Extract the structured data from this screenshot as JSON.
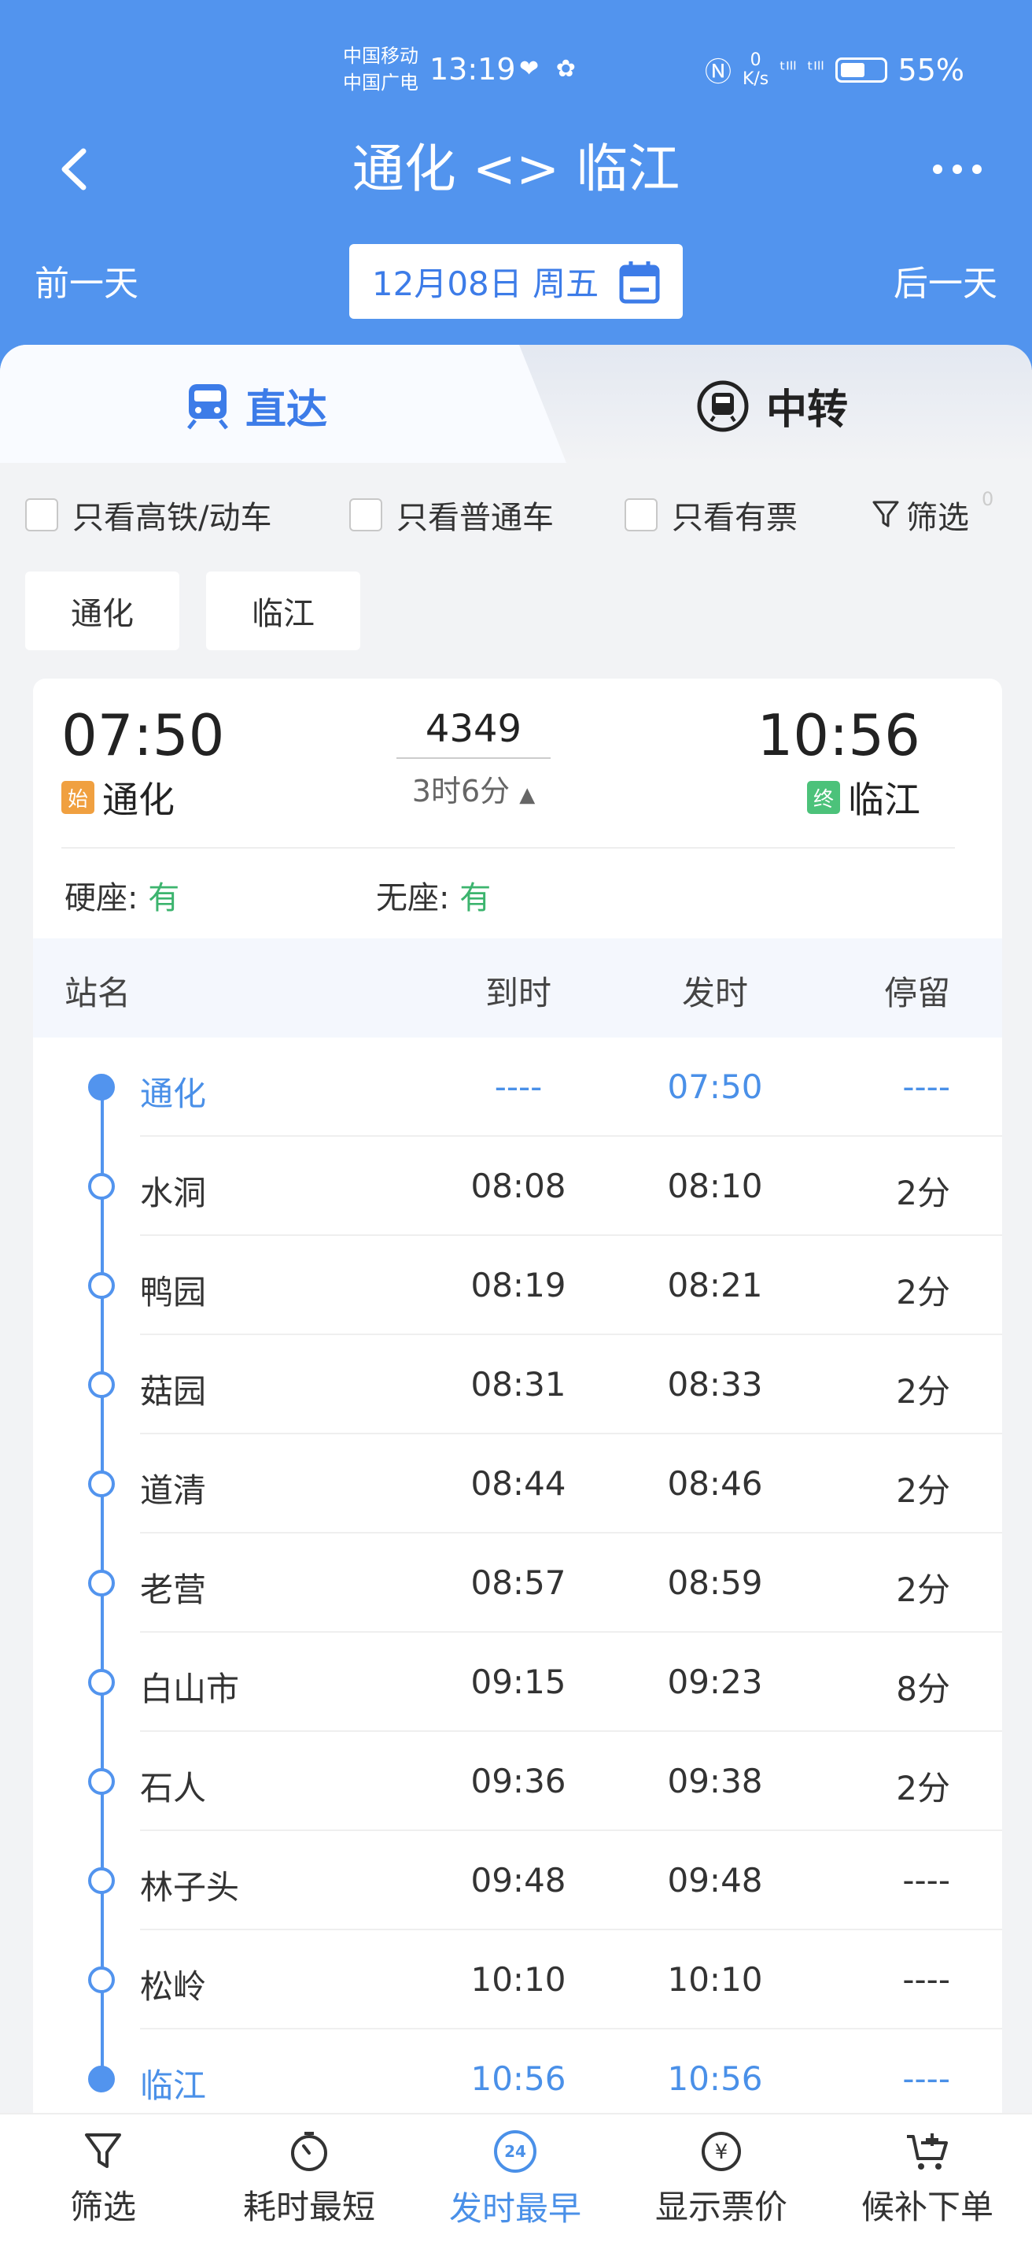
{
  "status_bar": {
    "carrier1": "中国移动",
    "carrier2": "中国广电",
    "time": "13:19",
    "net_speed_value": "0",
    "net_speed_unit": "K/s",
    "battery": "55%"
  },
  "nav": {
    "title": "通化 <> 临江"
  },
  "date_bar": {
    "prev": "前一天",
    "date": "12月08日 周五",
    "next": "后一天"
  },
  "tabs": [
    {
      "label": "直达"
    },
    {
      "label": "中转"
    }
  ],
  "filters": {
    "high_speed": "只看高铁/动车",
    "regular": "只看普通车",
    "has_ticket": "只看有票",
    "filter": "筛选",
    "filter_count": "0"
  },
  "station_chips": [
    "通化",
    "临江"
  ],
  "train": {
    "depart_time": "07:50",
    "depart_station": "通化",
    "start_badge": "始",
    "arrive_time": "10:56",
    "arrive_station": "临江",
    "end_badge": "终",
    "number": "4349",
    "duration": "3时6分",
    "seat1_label": "硬座:",
    "seat1_value": "有",
    "seat2_label": "无座:",
    "seat2_value": "有"
  },
  "table": {
    "headers": {
      "name": "站名",
      "arrive": "到时",
      "depart": "发时",
      "stay": "停留"
    },
    "rows": [
      {
        "name": "通化",
        "arrive": "----",
        "depart": "07:50",
        "stay": "----"
      },
      {
        "name": "水洞",
        "arrive": "08:08",
        "depart": "08:10",
        "stay": "2分"
      },
      {
        "name": "鸭园",
        "arrive": "08:19",
        "depart": "08:21",
        "stay": "2分"
      },
      {
        "name": "菇园",
        "arrive": "08:31",
        "depart": "08:33",
        "stay": "2分"
      },
      {
        "name": "道清",
        "arrive": "08:44",
        "depart": "08:46",
        "stay": "2分"
      },
      {
        "name": "老营",
        "arrive": "08:57",
        "depart": "08:59",
        "stay": "2分"
      },
      {
        "name": "白山市",
        "arrive": "09:15",
        "depart": "09:23",
        "stay": "8分"
      },
      {
        "name": "石人",
        "arrive": "09:36",
        "depart": "09:38",
        "stay": "2分"
      },
      {
        "name": "林子头",
        "arrive": "09:48",
        "depart": "09:48",
        "stay": "----"
      },
      {
        "name": "松岭",
        "arrive": "10:10",
        "depart": "10:10",
        "stay": "----"
      },
      {
        "name": "临江",
        "arrive": "10:56",
        "depart": "10:56",
        "stay": "----"
      }
    ]
  },
  "bottom_bar": {
    "filter": "筛选",
    "shortest": "耗时最短",
    "earliest": "发时最早",
    "earliest_icon_text": "24",
    "price": "显示票价",
    "waitlist": "候补下单"
  },
  "colors": {
    "primary": "#5294ee",
    "accent_text": "#4a90e8",
    "available": "#3cb46e",
    "start_badge": "#f0a040",
    "end_badge": "#4cc27a"
  }
}
